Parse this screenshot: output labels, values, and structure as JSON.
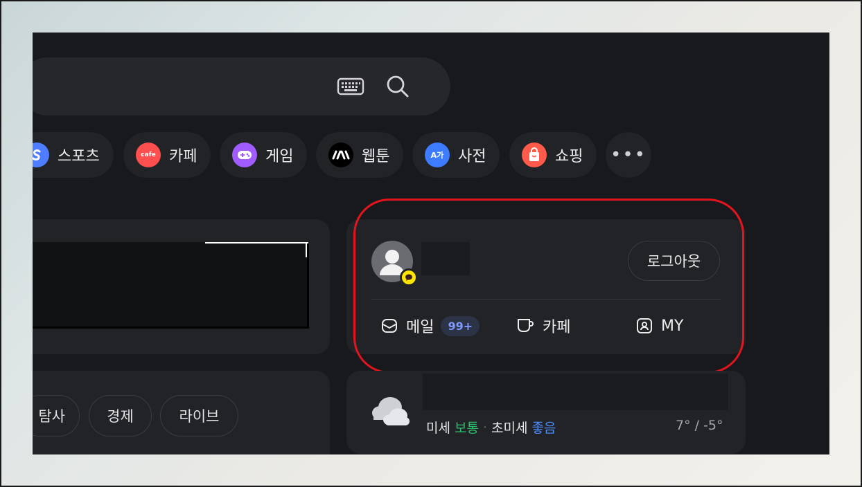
{
  "quick_links": [
    {
      "label": "스포츠",
      "icon": "sports-icon",
      "color": "#4f7dff"
    },
    {
      "label": "카페",
      "icon": "cafe-icon",
      "color": "#ff4f4f",
      "icon_text": "cafe"
    },
    {
      "label": "게임",
      "icon": "game-icon",
      "color": "#a05cff"
    },
    {
      "label": "웹툰",
      "icon": "webtoon-icon",
      "color": "#000000"
    },
    {
      "label": "사전",
      "icon": "dictionary-icon",
      "color": "#3d7bff",
      "icon_text": "A가"
    },
    {
      "label": "쇼핑",
      "icon": "shopping-icon",
      "color": "#ff5a4a"
    },
    {
      "label": "•••",
      "icon": "more-icon"
    }
  ],
  "login_card": {
    "logout_label": "로그아웃",
    "services": [
      {
        "label": "메일",
        "icon": "mail-icon",
        "badge": "99+"
      },
      {
        "label": "카페",
        "icon": "cafe-cup-icon"
      },
      {
        "label": "MY",
        "icon": "my-profile-icon"
      }
    ]
  },
  "news_tabs": [
    {
      "label": "탐사"
    },
    {
      "label": "경제"
    },
    {
      "label": "라이브"
    }
  ],
  "weather": {
    "dust_label": "미세",
    "dust_value": "보통",
    "fine_dust_label": "초미세",
    "fine_dust_value": "좋음",
    "separator": "·",
    "temperature": "7° / -5°",
    "colors": {
      "normal": "#2bbf6c",
      "good": "#4d8cff"
    }
  },
  "colors": {
    "panel_bg": "#18191c",
    "card_bg": "#222327",
    "highlight": "#e2151f",
    "badge_text": "#7d9bff"
  }
}
